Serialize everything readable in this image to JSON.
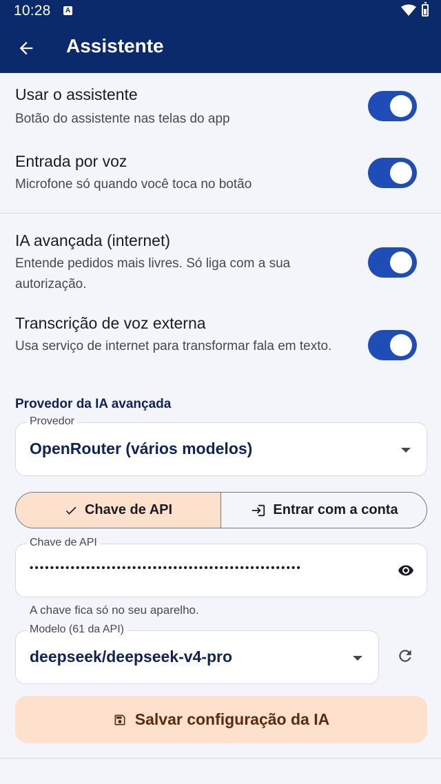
{
  "status_bar": {
    "time": "10:28",
    "notification_badge": "A"
  },
  "app_bar": {
    "title": "Assistente"
  },
  "settings": [
    {
      "title": "Usar o assistente",
      "subtitle": "Botão do assistente nas telas do app",
      "enabled": true
    },
    {
      "title": "Entrada por voz",
      "subtitle": "Microfone só quando você toca no botão",
      "enabled": true
    },
    {
      "title": "IA avançada (internet)",
      "subtitle": "Entende pedidos mais livres. Só liga com a sua autorização.",
      "enabled": true
    },
    {
      "title": "Transcrição de voz externa",
      "subtitle": "Usa serviço de internet para transformar fala em texto.",
      "enabled": true
    }
  ],
  "provider_section": {
    "title": "Provedor da IA avançada",
    "provider_label": "Provedor",
    "provider_value": "OpenRouter (vários modelos)",
    "auth_options": [
      "Chave de API",
      "Entrar com a conta"
    ],
    "selected_auth": "Chave de API",
    "api_key_label": "Chave de API",
    "api_key_masked": "•••••••••••••••••••••••••••••••••••••••••••••••••••••",
    "api_key_hint": "A chave fica só no seu aparelho.",
    "model_label": "Modelo (61 da API)",
    "model_value": "deepseek/deepseek-v4-pro",
    "save_label": "Salvar configuração da IA"
  },
  "colors": {
    "primary": "#0b2a6b",
    "switch_on": "#1e4db7",
    "tonal": "#fde1cc"
  }
}
